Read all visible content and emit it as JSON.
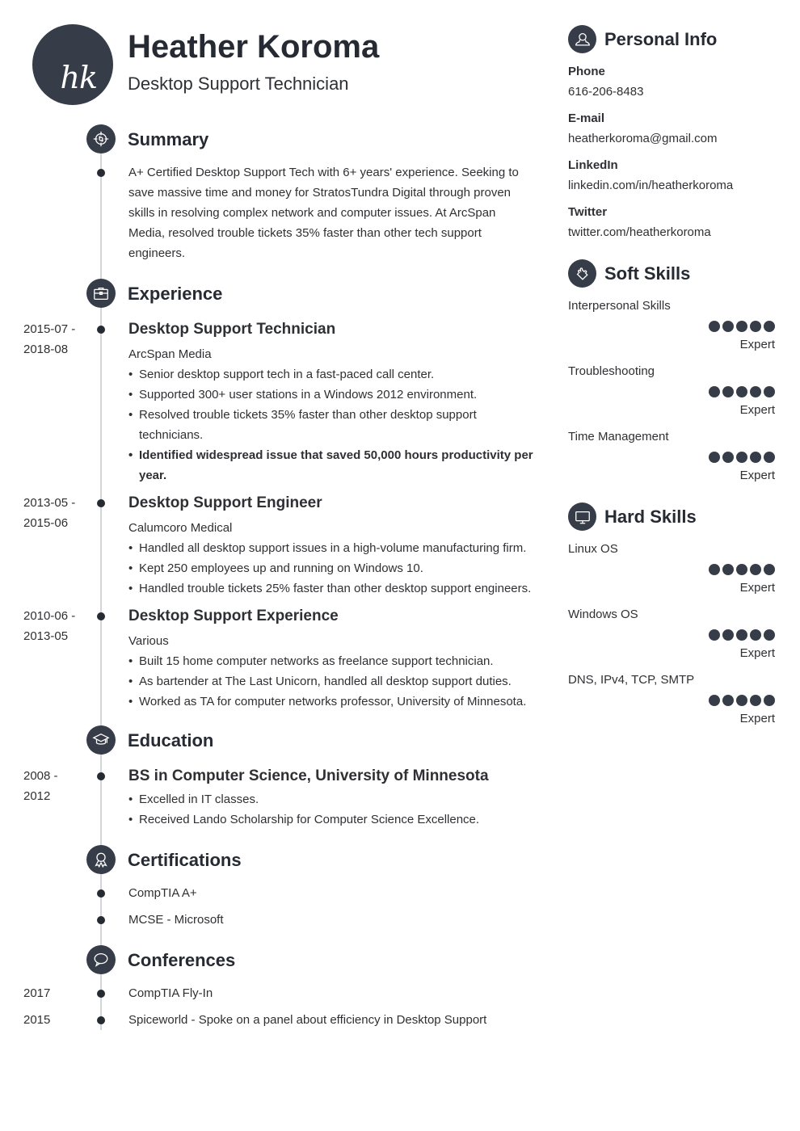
{
  "header": {
    "initials": "hk",
    "name": "Heather Koroma",
    "title": "Desktop Support Technician"
  },
  "summary": {
    "heading": "Summary",
    "icon": "target-icon",
    "text": "A+ Certified Desktop Support Tech with 6+ years' experience. Seeking to save massive time and money for StratosTundra Digital through proven skills in resolving complex network and computer issues. At ArcSpan Media, resolved trouble tickets 35% faster than other tech support engineers."
  },
  "experience": {
    "heading": "Experience",
    "icon": "briefcase-icon",
    "jobs": [
      {
        "date_start": "2015-07 -",
        "date_end": "2018-08",
        "title": "Desktop Support Technician",
        "company": "ArcSpan Media",
        "bullets": [
          {
            "text": "Senior desktop support tech in a fast-paced call center.",
            "bold": false
          },
          {
            "text": "Supported 300+ user stations in a Windows 2012 environment.",
            "bold": false
          },
          {
            "text": "Resolved trouble tickets 35% faster than other desktop support technicians.",
            "bold": false
          },
          {
            "text": "Identified widespread issue that saved 50,000 hours productivity per year.",
            "bold": true
          }
        ]
      },
      {
        "date_start": "2013-05 -",
        "date_end": "2015-06",
        "title": "Desktop Support Engineer",
        "company": "Calumcoro Medical",
        "bullets": [
          {
            "text": "Handled all desktop support issues in a high-volume manufacturing firm.",
            "bold": false
          },
          {
            "text": "Kept 250 employees up and running on Windows 10.",
            "bold": false
          },
          {
            "text": "Handled trouble tickets 25% faster than other desktop support engineers.",
            "bold": false
          }
        ]
      },
      {
        "date_start": "2010-06 -",
        "date_end": "2013-05",
        "title": "Desktop Support Experience",
        "company": "Various",
        "bullets": [
          {
            "text": "Built 15 home computer networks as freelance support technician.",
            "bold": false
          },
          {
            "text": "As bartender at The Last Unicorn, handled all desktop support duties.",
            "bold": false
          },
          {
            "text": "Worked as TA for computer networks professor, University of Minnesota.",
            "bold": false
          }
        ]
      }
    ]
  },
  "education": {
    "heading": "Education",
    "icon": "graduation-cap-icon",
    "items": [
      {
        "date_start": "2008 -",
        "date_end": "2012",
        "title": "BS in Computer Science, University of Minnesota",
        "bullets": [
          "Excelled in IT classes.",
          "Received Lando Scholarship for Computer Science Excellence."
        ]
      }
    ]
  },
  "certifications": {
    "heading": "Certifications",
    "icon": "award-ribbon-icon",
    "items": [
      "CompTIA A+",
      "MCSE - Microsoft"
    ]
  },
  "conferences": {
    "heading": "Conferences",
    "icon": "speech-bubble-icon",
    "items": [
      {
        "year": "2017",
        "text": "CompTIA Fly-In"
      },
      {
        "year": "2015",
        "text": "Spiceworld - Spoke on a panel about efficiency in Desktop Support"
      }
    ]
  },
  "personal_info": {
    "heading": "Personal Info",
    "icon": "user-icon",
    "fields": [
      {
        "label": "Phone",
        "value": "616-206-8483"
      },
      {
        "label": "E-mail",
        "value": "heatherkoroma@gmail.com"
      },
      {
        "label": "LinkedIn",
        "value": "linkedin.com/in/heatherkoroma"
      },
      {
        "label": "Twitter",
        "value": "twitter.com/heatherkoroma"
      }
    ]
  },
  "soft_skills": {
    "heading": "Soft Skills",
    "icon": "puzzle-piece-icon",
    "items": [
      {
        "name": "Interpersonal Skills",
        "rating": 5,
        "max": 5,
        "level": "Expert"
      },
      {
        "name": "Troubleshooting",
        "rating": 5,
        "max": 5,
        "level": "Expert"
      },
      {
        "name": "Time Management",
        "rating": 5,
        "max": 5,
        "level": "Expert"
      }
    ]
  },
  "hard_skills": {
    "heading": "Hard Skills",
    "icon": "monitor-icon",
    "items": [
      {
        "name": "Linux OS",
        "rating": 5,
        "max": 5,
        "level": "Expert"
      },
      {
        "name": "Windows OS",
        "rating": 5,
        "max": 5,
        "level": "Expert"
      },
      {
        "name": "DNS, IPv4, TCP, SMTP",
        "rating": 5,
        "max": 5,
        "level": "Expert"
      }
    ]
  },
  "colors": {
    "accent": "#373d48",
    "text": "#2f3033",
    "timeline": "#d4d5d8"
  }
}
